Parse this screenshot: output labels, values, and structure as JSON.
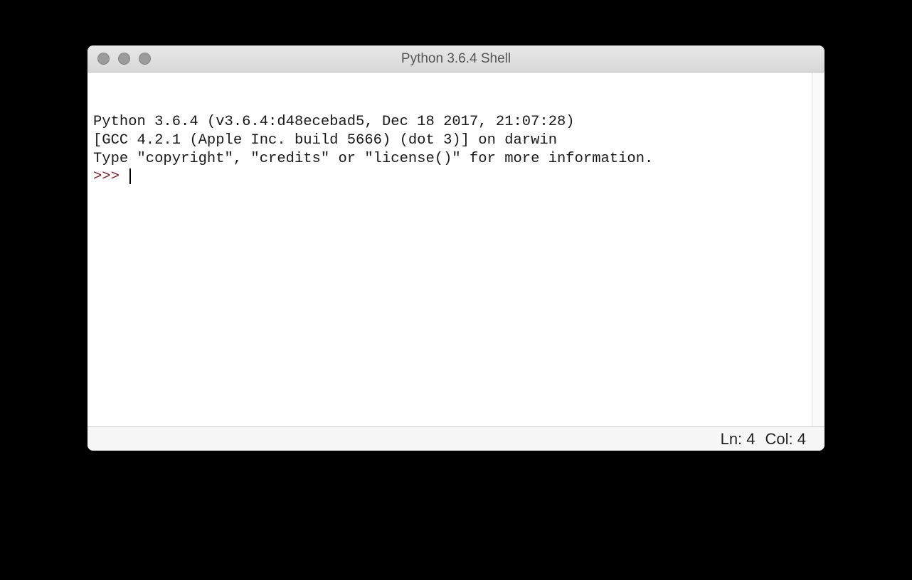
{
  "window": {
    "title": "Python 3.6.4 Shell"
  },
  "shell": {
    "line1": "Python 3.6.4 (v3.6.4:d48ecebad5, Dec 18 2017, 21:07:28) ",
    "line2": "[GCC 4.2.1 (Apple Inc. build 5666) (dot 3)] on darwin",
    "line3": "Type \"copyright\", \"credits\" or \"license()\" for more information.",
    "prompt": ">>> "
  },
  "status": {
    "ln_label": "Ln: 4",
    "col_label": "Col: 4"
  }
}
